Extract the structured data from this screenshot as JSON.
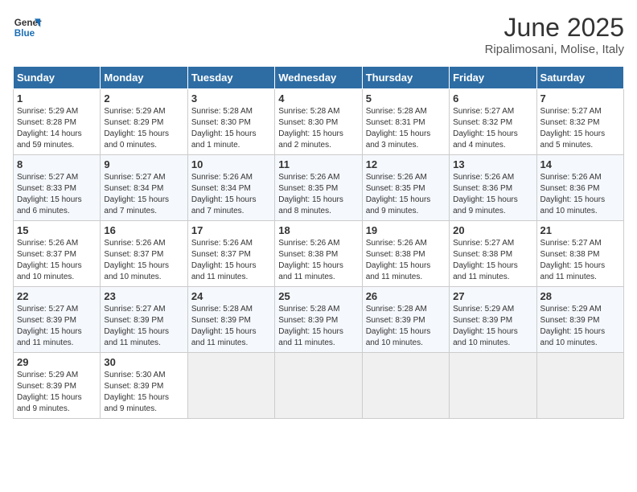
{
  "logo": {
    "line1": "General",
    "line2": "Blue"
  },
  "title": "June 2025",
  "subtitle": "Ripalimosani, Molise, Italy",
  "weekdays": [
    "Sunday",
    "Monday",
    "Tuesday",
    "Wednesday",
    "Thursday",
    "Friday",
    "Saturday"
  ],
  "weeks": [
    [
      {
        "day": "1",
        "info": "Sunrise: 5:29 AM\nSunset: 8:28 PM\nDaylight: 14 hours\nand 59 minutes."
      },
      {
        "day": "2",
        "info": "Sunrise: 5:29 AM\nSunset: 8:29 PM\nDaylight: 15 hours\nand 0 minutes."
      },
      {
        "day": "3",
        "info": "Sunrise: 5:28 AM\nSunset: 8:30 PM\nDaylight: 15 hours\nand 1 minute."
      },
      {
        "day": "4",
        "info": "Sunrise: 5:28 AM\nSunset: 8:30 PM\nDaylight: 15 hours\nand 2 minutes."
      },
      {
        "day": "5",
        "info": "Sunrise: 5:28 AM\nSunset: 8:31 PM\nDaylight: 15 hours\nand 3 minutes."
      },
      {
        "day": "6",
        "info": "Sunrise: 5:27 AM\nSunset: 8:32 PM\nDaylight: 15 hours\nand 4 minutes."
      },
      {
        "day": "7",
        "info": "Sunrise: 5:27 AM\nSunset: 8:32 PM\nDaylight: 15 hours\nand 5 minutes."
      }
    ],
    [
      {
        "day": "8",
        "info": "Sunrise: 5:27 AM\nSunset: 8:33 PM\nDaylight: 15 hours\nand 6 minutes."
      },
      {
        "day": "9",
        "info": "Sunrise: 5:27 AM\nSunset: 8:34 PM\nDaylight: 15 hours\nand 7 minutes."
      },
      {
        "day": "10",
        "info": "Sunrise: 5:26 AM\nSunset: 8:34 PM\nDaylight: 15 hours\nand 7 minutes."
      },
      {
        "day": "11",
        "info": "Sunrise: 5:26 AM\nSunset: 8:35 PM\nDaylight: 15 hours\nand 8 minutes."
      },
      {
        "day": "12",
        "info": "Sunrise: 5:26 AM\nSunset: 8:35 PM\nDaylight: 15 hours\nand 9 minutes."
      },
      {
        "day": "13",
        "info": "Sunrise: 5:26 AM\nSunset: 8:36 PM\nDaylight: 15 hours\nand 9 minutes."
      },
      {
        "day": "14",
        "info": "Sunrise: 5:26 AM\nSunset: 8:36 PM\nDaylight: 15 hours\nand 10 minutes."
      }
    ],
    [
      {
        "day": "15",
        "info": "Sunrise: 5:26 AM\nSunset: 8:37 PM\nDaylight: 15 hours\nand 10 minutes."
      },
      {
        "day": "16",
        "info": "Sunrise: 5:26 AM\nSunset: 8:37 PM\nDaylight: 15 hours\nand 10 minutes."
      },
      {
        "day": "17",
        "info": "Sunrise: 5:26 AM\nSunset: 8:37 PM\nDaylight: 15 hours\nand 11 minutes."
      },
      {
        "day": "18",
        "info": "Sunrise: 5:26 AM\nSunset: 8:38 PM\nDaylight: 15 hours\nand 11 minutes."
      },
      {
        "day": "19",
        "info": "Sunrise: 5:26 AM\nSunset: 8:38 PM\nDaylight: 15 hours\nand 11 minutes."
      },
      {
        "day": "20",
        "info": "Sunrise: 5:27 AM\nSunset: 8:38 PM\nDaylight: 15 hours\nand 11 minutes."
      },
      {
        "day": "21",
        "info": "Sunrise: 5:27 AM\nSunset: 8:38 PM\nDaylight: 15 hours\nand 11 minutes."
      }
    ],
    [
      {
        "day": "22",
        "info": "Sunrise: 5:27 AM\nSunset: 8:39 PM\nDaylight: 15 hours\nand 11 minutes."
      },
      {
        "day": "23",
        "info": "Sunrise: 5:27 AM\nSunset: 8:39 PM\nDaylight: 15 hours\nand 11 minutes."
      },
      {
        "day": "24",
        "info": "Sunrise: 5:28 AM\nSunset: 8:39 PM\nDaylight: 15 hours\nand 11 minutes."
      },
      {
        "day": "25",
        "info": "Sunrise: 5:28 AM\nSunset: 8:39 PM\nDaylight: 15 hours\nand 11 minutes."
      },
      {
        "day": "26",
        "info": "Sunrise: 5:28 AM\nSunset: 8:39 PM\nDaylight: 15 hours\nand 10 minutes."
      },
      {
        "day": "27",
        "info": "Sunrise: 5:29 AM\nSunset: 8:39 PM\nDaylight: 15 hours\nand 10 minutes."
      },
      {
        "day": "28",
        "info": "Sunrise: 5:29 AM\nSunset: 8:39 PM\nDaylight: 15 hours\nand 10 minutes."
      }
    ],
    [
      {
        "day": "29",
        "info": "Sunrise: 5:29 AM\nSunset: 8:39 PM\nDaylight: 15 hours\nand 9 minutes."
      },
      {
        "day": "30",
        "info": "Sunrise: 5:30 AM\nSunset: 8:39 PM\nDaylight: 15 hours\nand 9 minutes."
      },
      {
        "day": "",
        "info": ""
      },
      {
        "day": "",
        "info": ""
      },
      {
        "day": "",
        "info": ""
      },
      {
        "day": "",
        "info": ""
      },
      {
        "day": "",
        "info": ""
      }
    ]
  ]
}
